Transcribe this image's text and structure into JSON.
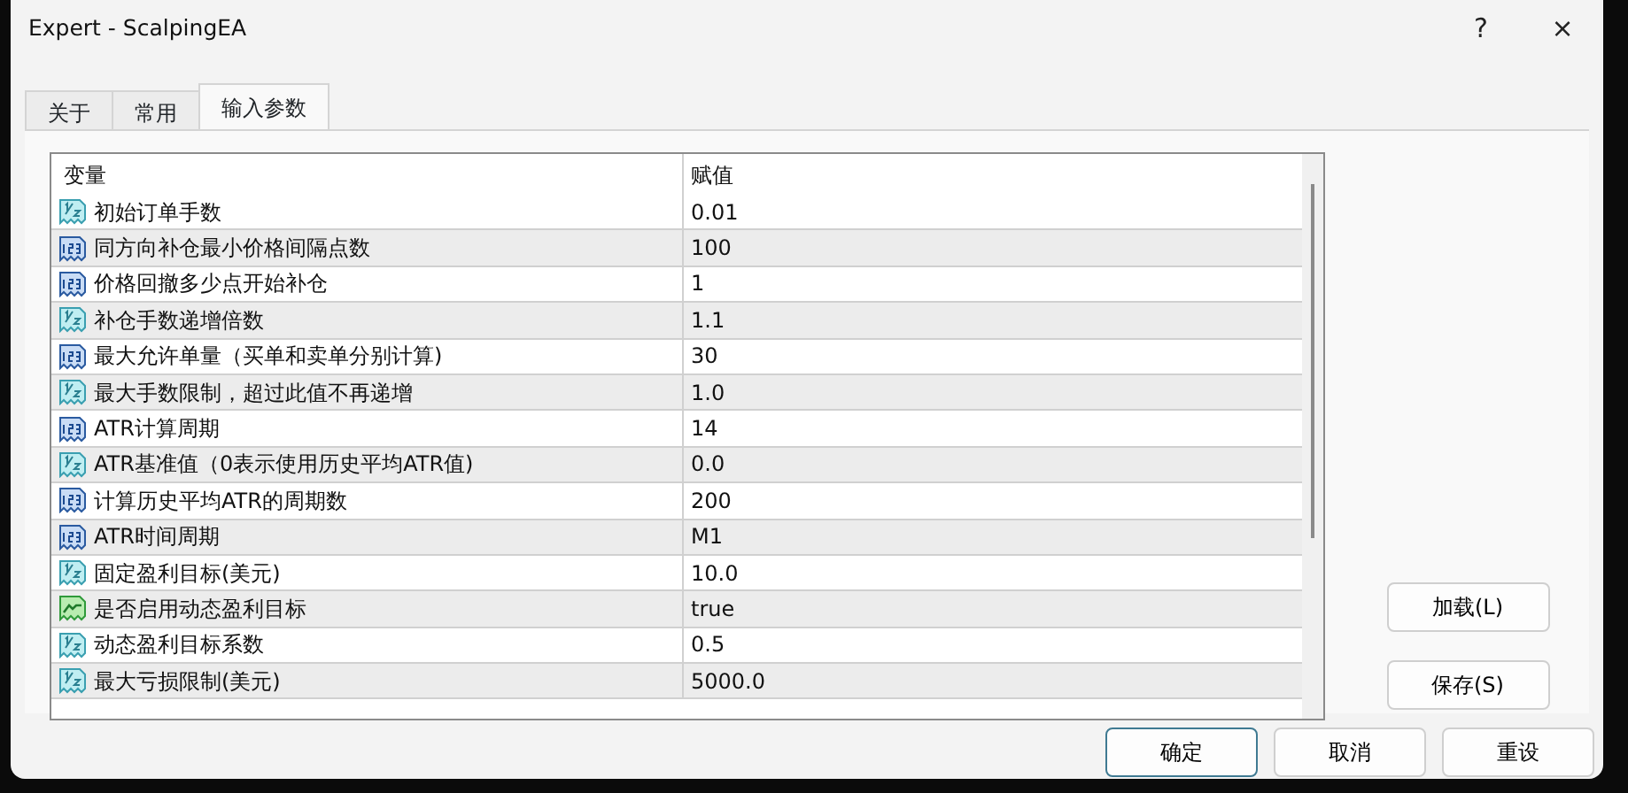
{
  "window": {
    "title": "Expert - ScalpingEA",
    "controls": [
      "?",
      "×"
    ]
  },
  "tabs": [
    {
      "label": "关于",
      "selected": false
    },
    {
      "label": "常用",
      "selected": false
    },
    {
      "label": "输入参数",
      "selected": true
    }
  ],
  "table": {
    "columns": [
      "变量",
      "赋值"
    ],
    "rows": [
      {
        "kind": "real",
        "name": "初始订单手数",
        "value": "0.01"
      },
      {
        "kind": "int",
        "name": "同方向补仓最小价格间隔点数",
        "value": "100"
      },
      {
        "kind": "int",
        "name": "价格回撤多少点开始补仓",
        "value": "1"
      },
      {
        "kind": "real",
        "name": "补仓手数递增倍数",
        "value": "1.1"
      },
      {
        "kind": "int",
        "name": "最大允许单量（买单和卖单分别计算)",
        "value": "30"
      },
      {
        "kind": "real",
        "name": "最大手数限制，超过此值不再递增",
        "value": "1.0"
      },
      {
        "kind": "int",
        "name": "ATR计算周期",
        "value": "14"
      },
      {
        "kind": "real",
        "name": "ATR基准值（0表示使用历史平均ATR值)",
        "value": "0.0"
      },
      {
        "kind": "int",
        "name": "计算历史平均ATR的周期数",
        "value": "200"
      },
      {
        "kind": "int",
        "name": "ATR时间周期",
        "value": "M1"
      },
      {
        "kind": "real",
        "name": "固定盈利目标(美元)",
        "value": "10.0"
      },
      {
        "kind": "bool",
        "name": "是否启用动态盈利目标",
        "value": "true"
      },
      {
        "kind": "real",
        "name": "动态盈利目标系数",
        "value": "0.5"
      },
      {
        "kind": "real",
        "name": "最大亏损限制(美元)",
        "value": "5000.0"
      }
    ]
  },
  "side_buttons": [
    "加载(L)",
    "保存(S)"
  ],
  "buttons": [
    {
      "label": "确定",
      "default": true
    },
    {
      "label": "取消",
      "default": false
    },
    {
      "label": "重设",
      "default": false
    }
  ]
}
